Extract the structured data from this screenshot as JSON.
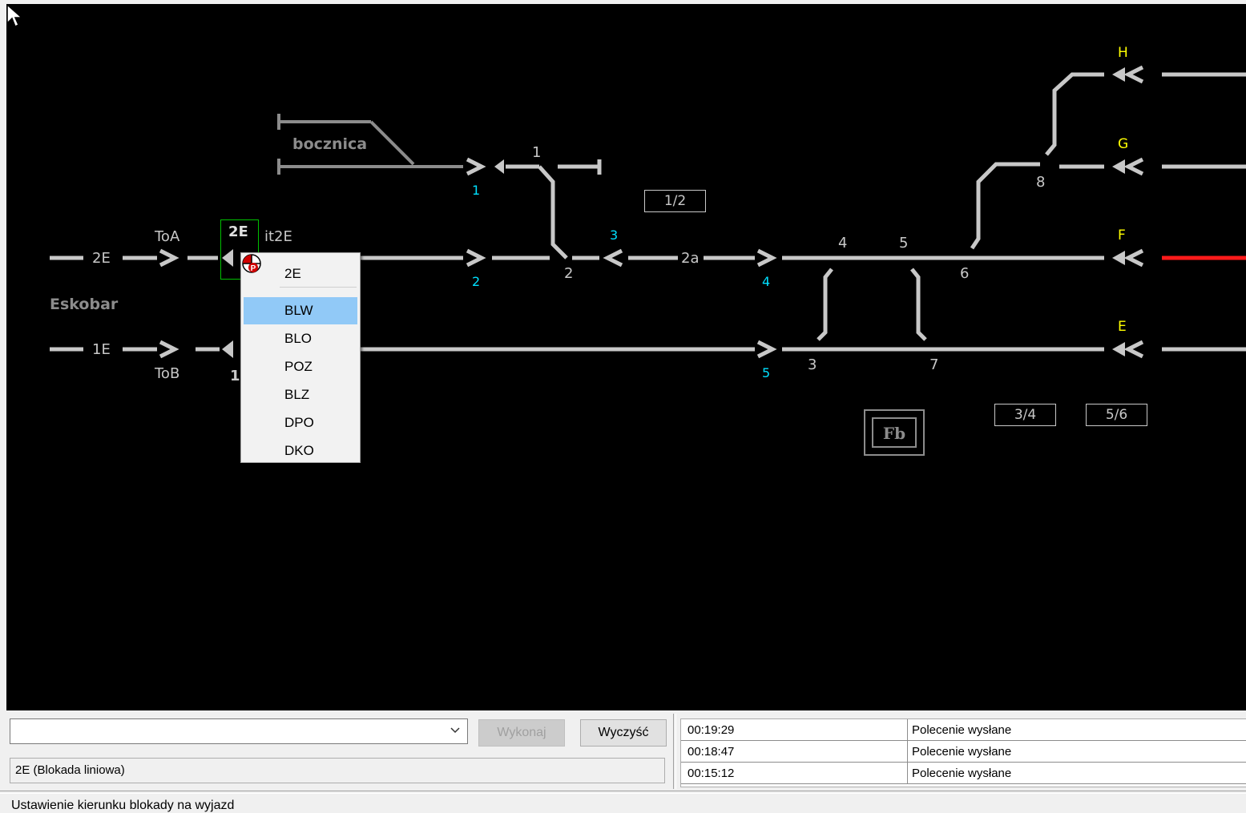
{
  "scheme": {
    "station_name": "Eskobar",
    "siding_label": "bocznica",
    "track_labels": {
      "line_2e": "2E",
      "line_1e": "1E",
      "toa": "ToA",
      "tob": "ToB",
      "sel_2e": "2E",
      "it2e": "it2E",
      "one_left": "1",
      "track_1": "1",
      "track_2": "2",
      "track_2a": "2a",
      "n4": "4",
      "n5": "5",
      "n6": "6",
      "n3": "3",
      "n7": "7",
      "n8": "8"
    },
    "signal_labels": {
      "s1": "1",
      "s2": "2",
      "s3": "3",
      "s4": "4",
      "s5": "5"
    },
    "exit_labels": {
      "H": "H",
      "G": "G",
      "F": "F",
      "E": "E"
    },
    "boxes": {
      "b12": "1/2",
      "b34": "3/4",
      "b56": "5/6",
      "fb": "Fb"
    },
    "colors": {
      "track": "#c8c8c8",
      "siding": "#8c8c8c",
      "signal_number": "#00e0ff",
      "exit_label": "#ffff00",
      "occupied": "#ff1a1a",
      "selection": "#00c000"
    }
  },
  "context_menu": {
    "header": "2E",
    "items": [
      "BLW",
      "BLO",
      "POZ",
      "BLZ",
      "DPO",
      "DKO"
    ],
    "highlighted": "BLW"
  },
  "command_bar": {
    "select_value": "",
    "execute_label": "Wykonaj",
    "clear_label": "Wyczyść",
    "info_text": "2E (Blokada liniowa)"
  },
  "log": [
    {
      "time": "00:19:29",
      "message": "Polecenie wysłane"
    },
    {
      "time": "00:18:47",
      "message": "Polecenie wysłane"
    },
    {
      "time": "00:15:12",
      "message": "Polecenie wysłane"
    }
  ],
  "status_bar": "Ustawienie kierunku blokady na wyjazd"
}
